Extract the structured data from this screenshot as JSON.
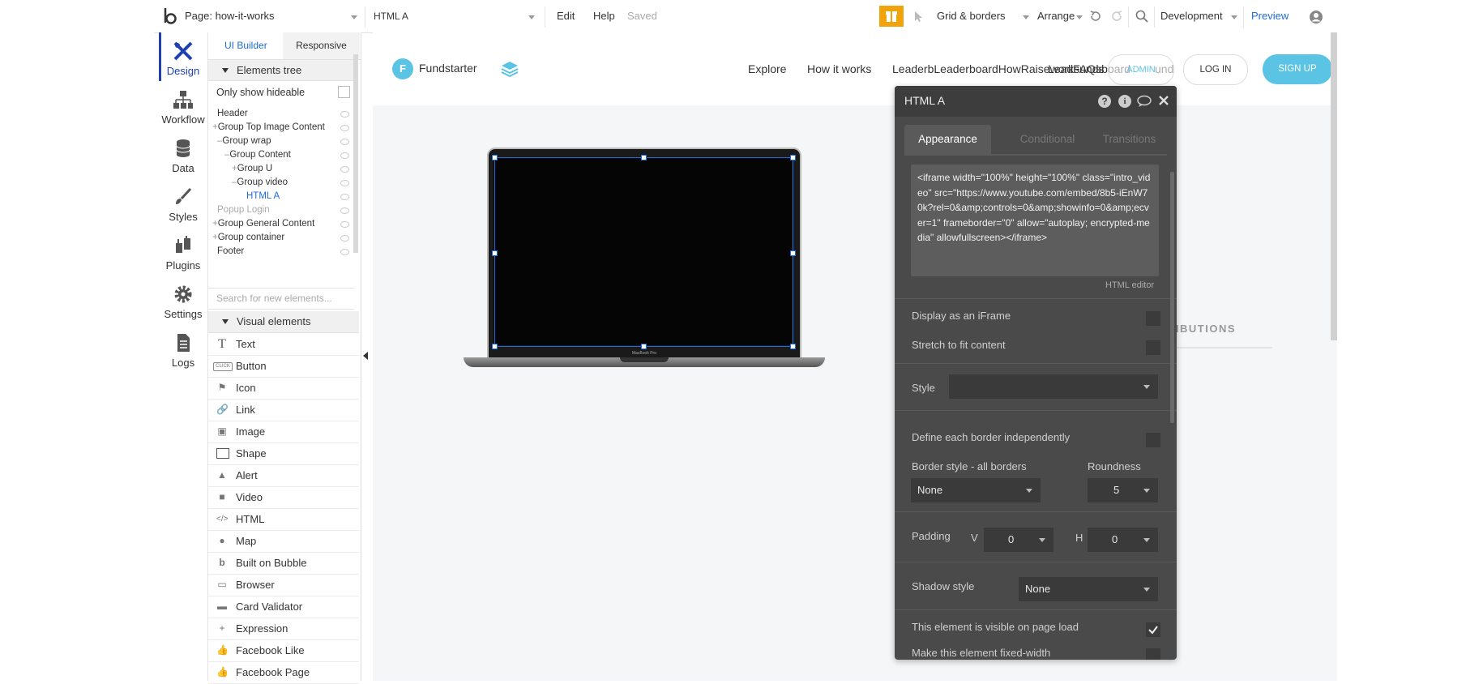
{
  "topbar": {
    "page_label": "Page: how-it-works",
    "element_select": "HTML A",
    "edit": "Edit",
    "help": "Help",
    "saved": "Saved",
    "grid_borders": "Grid & borders",
    "arrange": "Arrange",
    "environment": "Development",
    "preview": "Preview"
  },
  "nav": {
    "design": "Design",
    "workflow": "Workflow",
    "data": "Data",
    "styles": "Styles",
    "plugins": "Plugins",
    "settings": "Settings",
    "logs": "Logs"
  },
  "panel": {
    "tab_ui": "UI Builder",
    "tab_responsive": "Responsive",
    "tree_title": "Elements tree",
    "only_hideable": "Only show hideable",
    "tree": [
      "Header",
      "Group Top Image Content",
      "Group wrap",
      "Group Content",
      "Group U",
      "Group video",
      "HTML A",
      "Popup Login",
      "Group General Content",
      "Group container",
      "Footer"
    ],
    "search_placeholder": "Search for new elements...",
    "visual_title": "Visual elements",
    "visual": [
      "Text",
      "Button",
      "Icon",
      "Link",
      "Image",
      "Shape",
      "Alert",
      "Video",
      "HTML",
      "Map",
      "Built on Bubble",
      "Browser",
      "Card Validator",
      "Expression",
      "Facebook Like",
      "Facebook Page"
    ],
    "button_icon_text": "CLICK"
  },
  "site": {
    "brand_letter": "F",
    "brand": "Fundstarter",
    "nav": [
      "Explore",
      "How it works"
    ],
    "overlap_text": "LeaderbLeaderboardHowRaiseworksunds",
    "overlap_text2": "LeadFAQsboard",
    "overlap_text3": "und",
    "admin": "ADMIN",
    "login": "LOG IN",
    "signup": "SIGN UP",
    "laptop_label": "MacBook Pro",
    "behind_text": "RIBUTIONS"
  },
  "editor": {
    "title": "HTML A",
    "tabs": [
      "Appearance",
      "Conditional",
      "Transitions"
    ],
    "code": "<iframe width=\"100%\" height=\"100%\" class=\"intro_video\" src=\"https://www.youtube.com/embed/8b5-iEnW70k?rel=0&amp;controls=0&amp;showinfo=0&amp;ecver=1\" frameborder=\"0\" allow=\"autoplay; encrypted-media\" allowfullscreen></iframe>",
    "html_editor": "HTML editor",
    "display_iframe": "Display as an iFrame",
    "stretch": "Stretch to fit content",
    "style": "Style",
    "style_value": "",
    "define_border": "Define each border independently",
    "border_style": "Border style - all borders",
    "roundness": "Roundness",
    "border_value": "None",
    "roundness_value": "5",
    "padding": "Padding",
    "pad_v": "V",
    "pad_v_value": "0",
    "pad_h": "H",
    "pad_h_value": "0",
    "shadow_style": "Shadow style",
    "shadow_value": "None",
    "visible_load": "This element is visible on page load",
    "fixed_width": "Make this element fixed-width"
  },
  "colors": {
    "accent": "#1e6bdc",
    "design_active": "#2040b0",
    "signup": "#5bc4e5",
    "gift": "#f0a30a"
  }
}
